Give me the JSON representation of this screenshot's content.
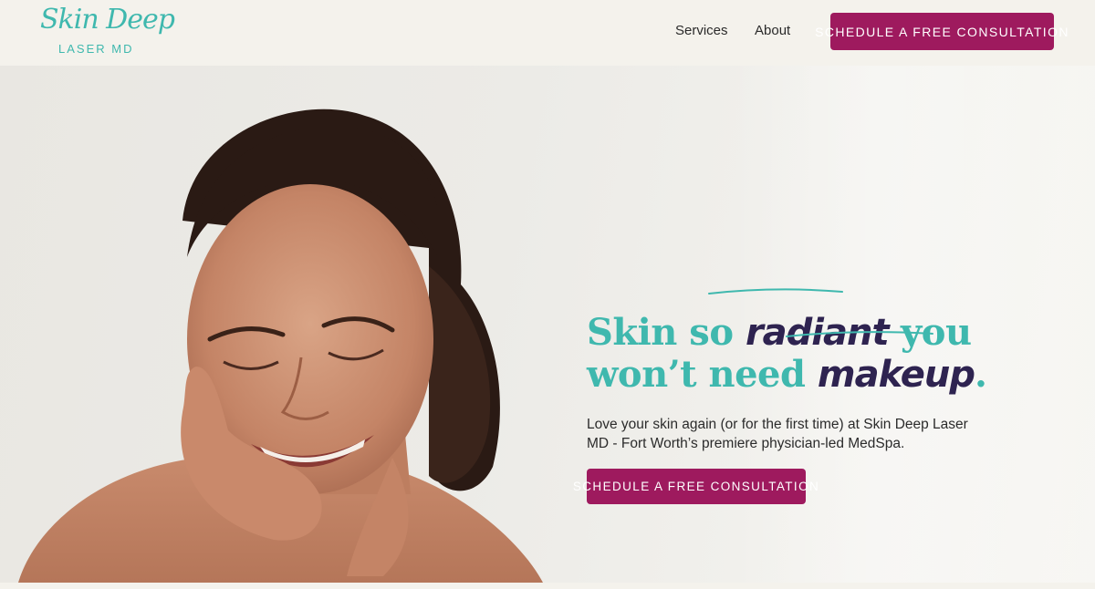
{
  "header": {
    "logo_script": "Skin Deep",
    "logo_sub": "LASER MD",
    "nav": [
      {
        "label": "Services"
      },
      {
        "label": "About"
      }
    ],
    "cta_label": "SCHEDULE A FREE CONSULTATION"
  },
  "hero": {
    "headline": {
      "part1": "Skin so ",
      "em1": "radiant",
      "part2": " you",
      "part3": "won’t need ",
      "em2": "makeup",
      "period": "."
    },
    "subtext": "Love your skin again (or for the first time) at Skin Deep Laser MD - Fort Worth’s premiere physician-led MedSpa.",
    "cta_label": "SCHEDULE A FREE CONSULTATION"
  },
  "colors": {
    "brand_teal": "#3fb8ae",
    "brand_magenta": "#9e1a5e",
    "accent_navy": "#2e2350",
    "background": "#f4f2ec"
  }
}
